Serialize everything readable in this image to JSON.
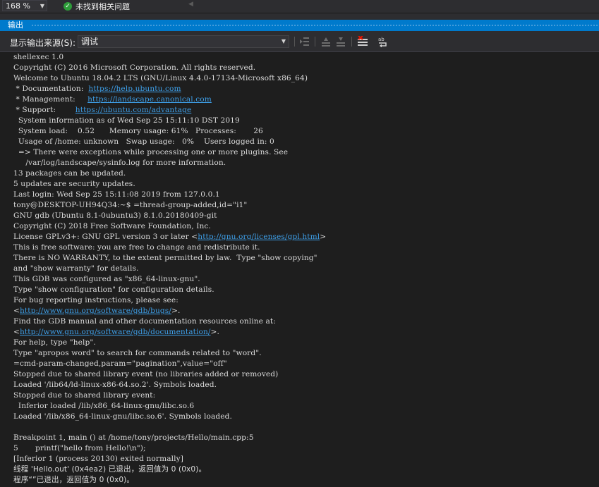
{
  "topbar": {
    "zoom": "168 %",
    "status": "未找到相关问题"
  },
  "panel": {
    "title": "输出",
    "source_label": "显示输出来源(S):",
    "source_value": "调试"
  },
  "icons": {
    "status": "check-circle-icon",
    "toolbar": [
      "goto-location-icon",
      "previous-message-icon",
      "next-message-icon",
      "clear-all-icon",
      "word-wrap-icon"
    ]
  },
  "colors": {
    "accent": "#007acc",
    "background": "#1e1e1e",
    "text": "#dcdcdc",
    "link": "#3e9fe8",
    "ok": "#2e9d3a"
  },
  "output": {
    "lines": [
      {
        "segments": [
          {
            "text": "shellexec 1.0"
          }
        ]
      },
      {
        "segments": [
          {
            "text": "Copyright (C) 2016 Microsoft Corporation. All rights reserved."
          }
        ]
      },
      {
        "segments": [
          {
            "text": "Welcome to Ubuntu 18.04.2 LTS (GNU/Linux 4.4.0-17134-Microsoft x86_64)"
          }
        ]
      },
      {
        "segments": [
          {
            "text": " * Documentation:  "
          },
          {
            "text": "https://help.ubuntu.com",
            "link": true
          }
        ]
      },
      {
        "segments": [
          {
            "text": " * Management:     "
          },
          {
            "text": "https://landscape.canonical.com",
            "link": true
          }
        ]
      },
      {
        "segments": [
          {
            "text": " * Support:        "
          },
          {
            "text": "https://ubuntu.com/advantage",
            "link": true
          }
        ]
      },
      {
        "segments": [
          {
            "text": "  System information as of Wed Sep 25 15:11:10 DST 2019"
          }
        ]
      },
      {
        "segments": [
          {
            "text": "  System load:    0.52      Memory usage: 61%   Processes:       26"
          }
        ]
      },
      {
        "segments": [
          {
            "text": "  Usage of /home: unknown   Swap usage:   0%    Users logged in: 0"
          }
        ]
      },
      {
        "segments": [
          {
            "text": "  => There were exceptions while processing one or more plugins. See"
          }
        ]
      },
      {
        "segments": [
          {
            "text": "     /var/log/landscape/sysinfo.log for more information."
          }
        ]
      },
      {
        "segments": [
          {
            "text": "13 packages can be updated."
          }
        ]
      },
      {
        "segments": [
          {
            "text": "5 updates are security updates."
          }
        ]
      },
      {
        "segments": [
          {
            "text": "Last login: Wed Sep 25 15:11:08 2019 from 127.0.0.1"
          }
        ]
      },
      {
        "segments": [
          {
            "text": "tony@DESKTOP-UH94Q34:~$ =thread-group-added,id=\"i1\""
          }
        ]
      },
      {
        "segments": [
          {
            "text": "GNU gdb (Ubuntu 8.1-0ubuntu3) 8.1.0.20180409-git"
          }
        ]
      },
      {
        "segments": [
          {
            "text": "Copyright (C) 2018 Free Software Foundation, Inc."
          }
        ]
      },
      {
        "segments": [
          {
            "text": "License GPLv3+: GNU GPL version 3 or later <"
          },
          {
            "text": "http://gnu.org/licenses/gpl.html",
            "link": true
          },
          {
            "text": ">"
          }
        ]
      },
      {
        "segments": [
          {
            "text": "This is free software: you are free to change and redistribute it."
          }
        ]
      },
      {
        "segments": [
          {
            "text": "There is NO WARRANTY, to the extent permitted by law.  Type \"show copying\""
          }
        ]
      },
      {
        "segments": [
          {
            "text": "and \"show warranty\" for details."
          }
        ]
      },
      {
        "segments": [
          {
            "text": "This GDB was configured as \"x86_64-linux-gnu\"."
          }
        ]
      },
      {
        "segments": [
          {
            "text": "Type \"show configuration\" for configuration details."
          }
        ]
      },
      {
        "segments": [
          {
            "text": "For bug reporting instructions, please see:"
          }
        ]
      },
      {
        "segments": [
          {
            "text": "<"
          },
          {
            "text": "http://www.gnu.org/software/gdb/bugs/",
            "link": true
          },
          {
            "text": ">."
          }
        ]
      },
      {
        "segments": [
          {
            "text": "Find the GDB manual and other documentation resources online at:"
          }
        ]
      },
      {
        "segments": [
          {
            "text": "<"
          },
          {
            "text": "http://www.gnu.org/software/gdb/documentation/",
            "link": true
          },
          {
            "text": ">."
          }
        ]
      },
      {
        "segments": [
          {
            "text": "For help, type \"help\"."
          }
        ]
      },
      {
        "segments": [
          {
            "text": "Type \"apropos word\" to search for commands related to \"word\"."
          }
        ]
      },
      {
        "segments": [
          {
            "text": "=cmd-param-changed,param=\"pagination\",value=\"off\""
          }
        ]
      },
      {
        "segments": [
          {
            "text": "Stopped due to shared library event (no libraries added or removed)"
          }
        ]
      },
      {
        "segments": [
          {
            "text": "Loaded '/lib64/ld-linux-x86-64.so.2'. Symbols loaded."
          }
        ]
      },
      {
        "segments": [
          {
            "text": "Stopped due to shared library event:"
          }
        ]
      },
      {
        "segments": [
          {
            "text": "  Inferior loaded /lib/x86_64-linux-gnu/libc.so.6"
          }
        ]
      },
      {
        "segments": [
          {
            "text": "Loaded '/lib/x86_64-linux-gnu/libc.so.6'. Symbols loaded."
          }
        ]
      },
      {
        "segments": [
          {
            "text": ""
          }
        ]
      },
      {
        "segments": [
          {
            "text": "Breakpoint 1, main () at /home/tony/projects/Hello/main.cpp:5"
          }
        ]
      },
      {
        "segments": [
          {
            "text": "5       printf(\"hello from Hello!\\n\");"
          }
        ]
      },
      {
        "segments": [
          {
            "text": "[Inferior 1 (process 20130) exited normally]"
          }
        ]
      },
      {
        "segments": [
          {
            "text": "线程 'Hello.out' (0x4ea2) 已退出，返回值为 0 (0x0)。"
          }
        ]
      },
      {
        "segments": [
          {
            "text": "程序“”已退出，返回值为 0 (0x0)。"
          }
        ]
      }
    ]
  }
}
